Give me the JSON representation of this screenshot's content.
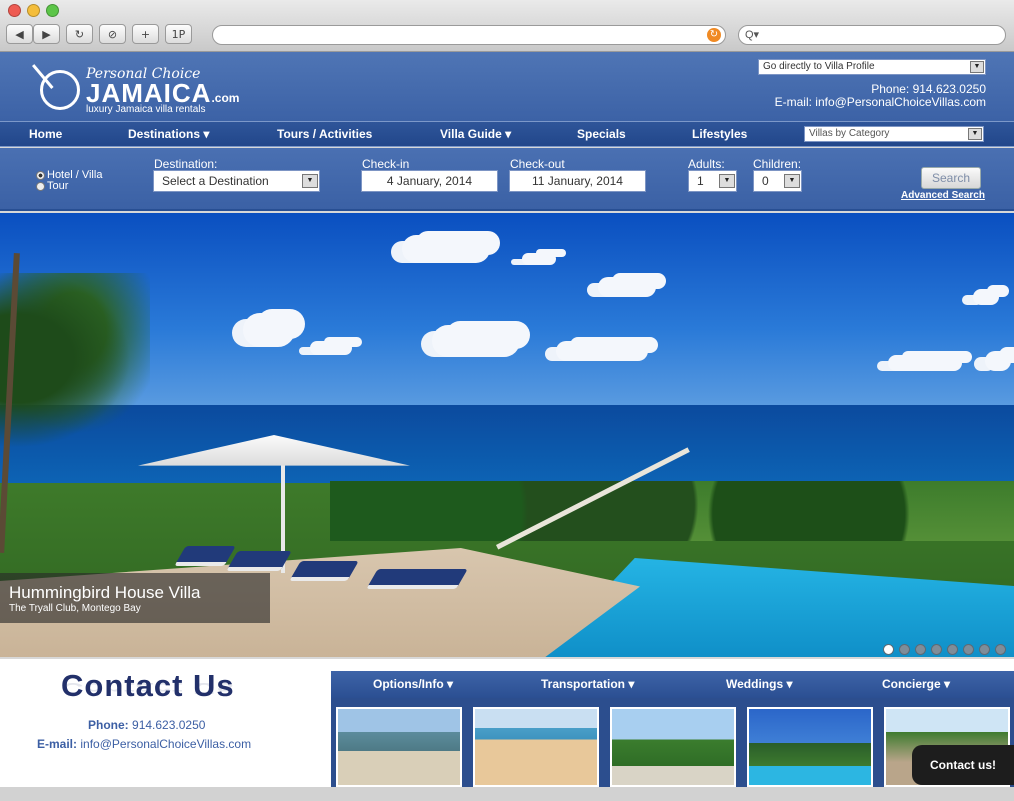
{
  "browser": {
    "back": "◀",
    "forward": "▶",
    "reload": "↻",
    "stop": "⊘",
    "add": "+",
    "onep": "1P",
    "search_prefix": "Q▾"
  },
  "header": {
    "logo_script": "Personal Choice",
    "logo_main": "JAMAICA",
    "logo_dotcom": ".com",
    "tagline": "luxury Jamaica villa rentals",
    "villa_profile_select": "Go directly to Villa Profile",
    "phone": "Phone: 914.623.0250",
    "email": "E-mail: info@PersonalChoiceVillas.com"
  },
  "nav": {
    "items": [
      "Home",
      "Destinations ▾",
      "Tours / Activities",
      "Villa Guide ▾",
      "Specials",
      "Lifestyles"
    ],
    "category_select": "Villas by Category"
  },
  "search": {
    "radio_villa": "Hotel / Villa",
    "radio_tour": "Tour",
    "destination_label": "Destination:",
    "destination_value": "Select a Destination",
    "checkin_label": "Check-in",
    "checkin_value": "4 January, 2014",
    "checkout_label": "Check-out",
    "checkout_value": "11 January, 2014",
    "adults_label": "Adults:",
    "adults_value": "1",
    "children_label": "Children:",
    "children_value": "0",
    "search_button": "Search",
    "advanced_link": "Advanced Search"
  },
  "hero": {
    "title": "Hummingbird House Villa",
    "subtitle": "The Tryall Club, Montego Bay",
    "slide_count": 8,
    "active_slide": 1
  },
  "contact": {
    "title": "Contact Us",
    "phone_key": "Phone:",
    "phone": "914.623.0250",
    "email_key": "E-mail:",
    "email": "info@PersonalChoiceVillas.com"
  },
  "subnav": {
    "items": [
      "Options/Info ▾",
      "Transportation ▾",
      "Weddings ▾",
      "Concierge ▾"
    ]
  },
  "chat": {
    "label": "Contact us!"
  },
  "colors": {
    "brand_blue": "#3c62a6",
    "nav_blue": "#2a4e90",
    "contact_navy": "#22306a"
  }
}
